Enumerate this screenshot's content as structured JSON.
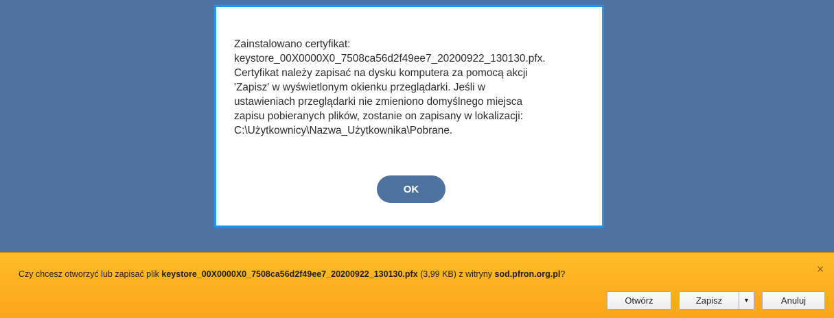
{
  "dialog": {
    "message_lines": [
      "Zainstalowano certyfikat:",
      "keystore_00X0000X0_7508ca56d2f49ee7_20200922_130130.pfx.",
      "Certyfikat należy zapisać na dysku komputera za pomocą akcji",
      "'Zapisz' w wyświetlonym okienku przeglądarki. Jeśli w",
      "ustawieniach przeglądarki nie zmieniono domyślnego miejsca",
      "zapisu pobieranych plików, zostanie on zapisany w lokalizacji:",
      "C:\\Użytkownicy\\Nazwa_Użytkownika\\Pobrane."
    ],
    "ok_label": "OK"
  },
  "download_bar": {
    "prompt_prefix": "Czy chcesz otworzyć lub zapisać plik ",
    "file_name": "keystore_00X0000X0_7508ca56d2f49ee7_20200922_130130.pfx",
    "size_text": " (3,99 KB) z witryny ",
    "site": "sod.pfron.org.pl",
    "prompt_suffix": "?",
    "close_glyph": "×",
    "open_label": "Otwórz",
    "save_label": "Zapisz",
    "save_dropdown_glyph": "▼",
    "cancel_label": "Anuluj"
  },
  "colors": {
    "backdrop": "#4f72a0",
    "dialog_border": "#2196f3",
    "ok_button": "#4e729e",
    "download_bar": "#fdbd25"
  }
}
